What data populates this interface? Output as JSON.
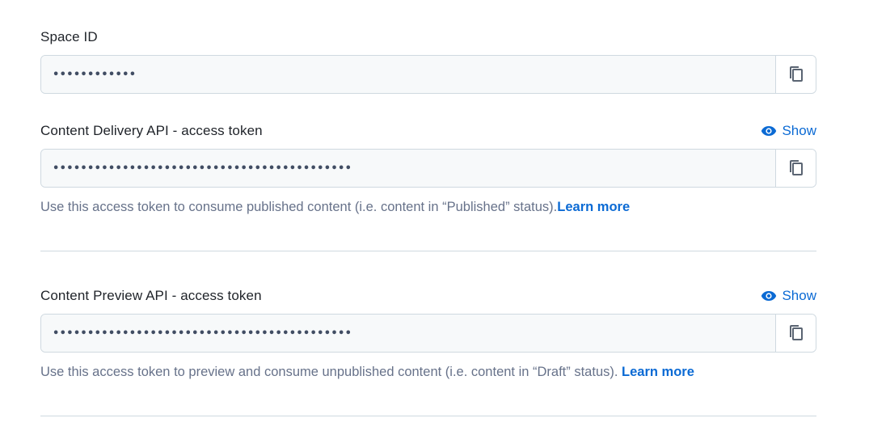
{
  "space_id": {
    "label": "Space ID",
    "value": "••••••••••••",
    "copy_icon": "copy-icon"
  },
  "delivery_token": {
    "label": "Content Delivery API - access token",
    "show_label": "Show",
    "value": "•••••••••••••••••••••••••••••••••••••••••••",
    "help_text": "Use this access token to consume published content (i.e. content in “Published” status).",
    "learn_more": "Learn more"
  },
  "preview_token": {
    "label": "Content Preview API - access token",
    "show_label": "Show",
    "value": "•••••••••••••••••••••••••••••••••••••••••••",
    "help_text": "Use this access token to preview and consume unpublished content (i.e. content in “Draft” status). ",
    "learn_more": "Learn more"
  },
  "colors": {
    "link": "#0b6ad4",
    "border": "#cfd9e0",
    "field_bg": "#f7f9fa",
    "help_text": "#67728a"
  }
}
